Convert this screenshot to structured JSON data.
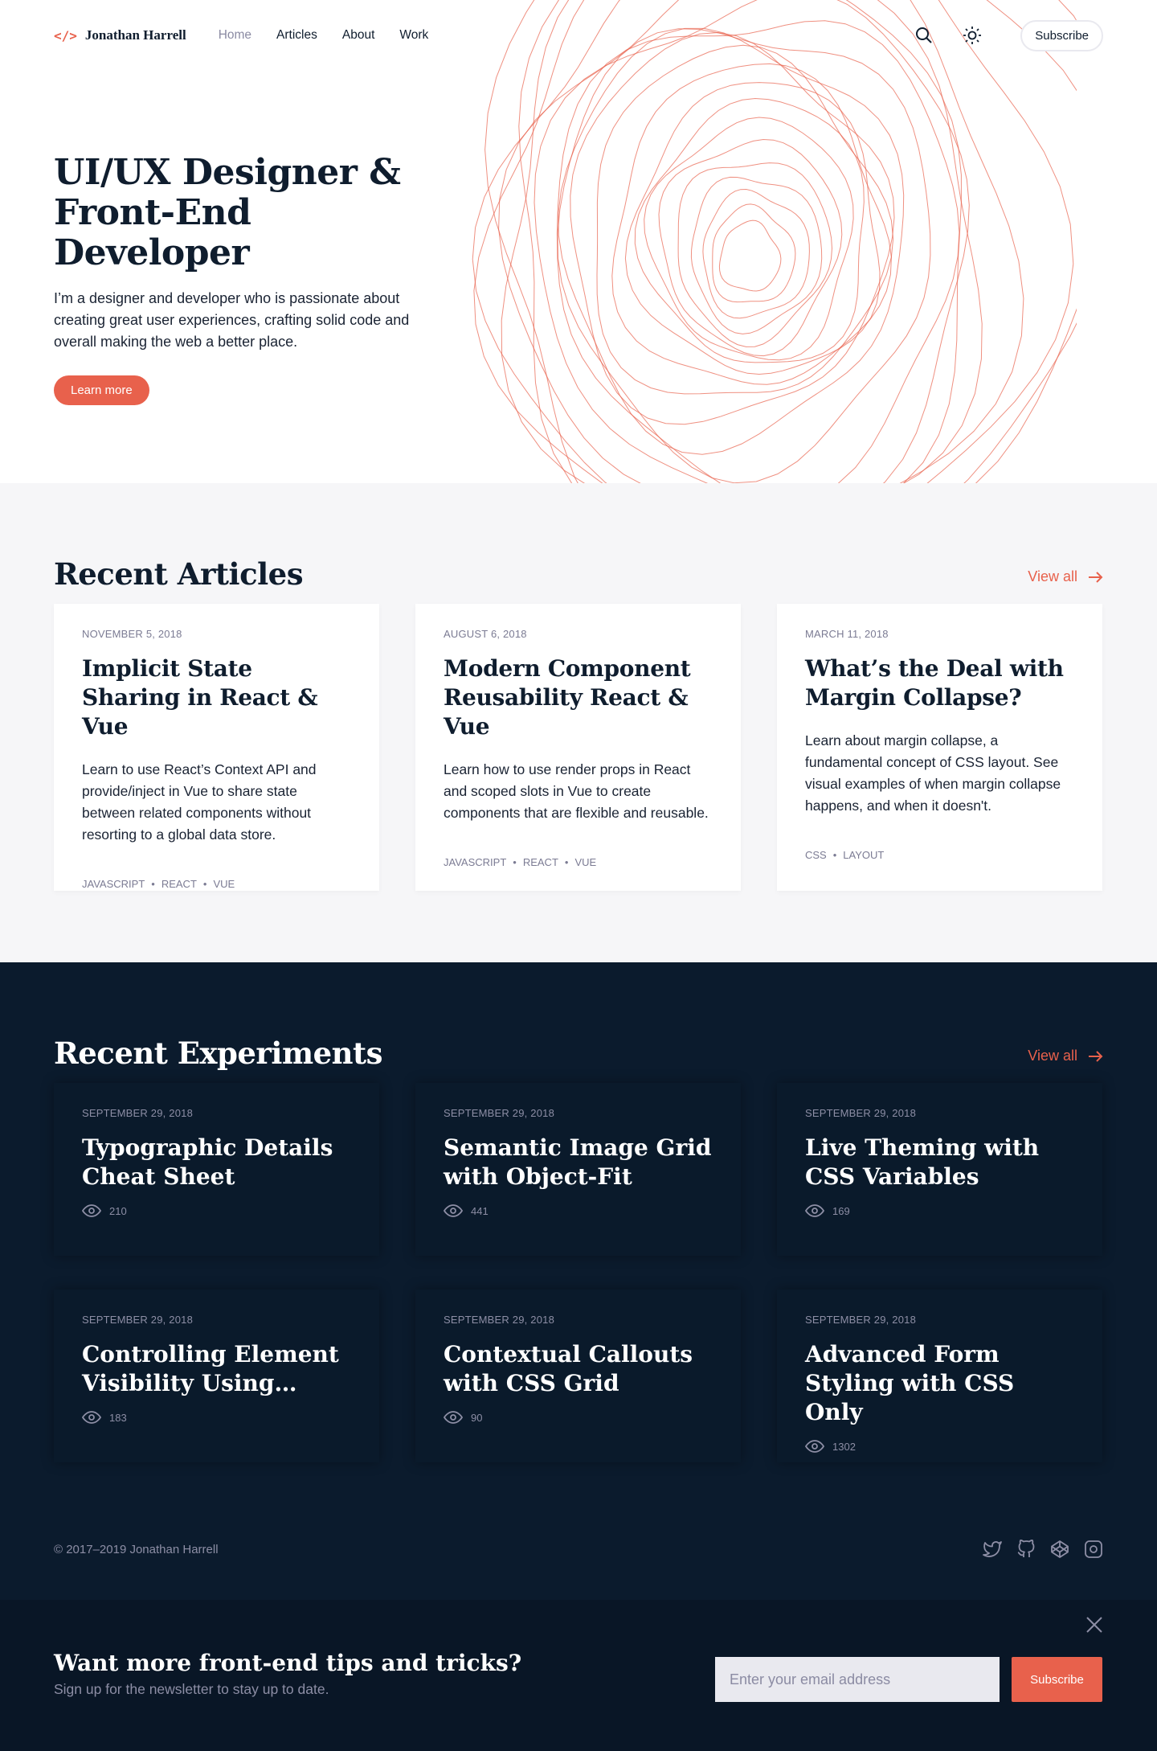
{
  "header": {
    "brand": "Jonathan Harrell",
    "nav": [
      "Home",
      "Articles",
      "About",
      "Work"
    ],
    "subscribe": "Subscribe"
  },
  "hero": {
    "title_line1": "UI/UX Designer &",
    "title_line2": "Front-End Developer",
    "body": "I’m a designer and developer who is passionate about creating great user experiences, crafting solid code and overall making the web a better place.",
    "cta": "Learn more"
  },
  "articles": {
    "heading": "Recent Articles",
    "view_all": "View all",
    "items": [
      {
        "date": "November 5, 2018",
        "title": "Implicit State Sharing in React & Vue",
        "desc": "Learn to use React’s Context API and provide/inject in Vue to share state between related components without resorting to a global data store.",
        "tags": [
          "JAVASCRIPT",
          "REACT",
          "VUE"
        ]
      },
      {
        "date": "August 6, 2018",
        "title": "Modern Component Reusability React & Vue",
        "desc": "Learn how to use render props in React and scoped slots in Vue to create components that are flexible and reusable.",
        "tags": [
          "JAVASCRIPT",
          "REACT",
          "VUE"
        ]
      },
      {
        "date": "March 11, 2018",
        "title": "What’s the Deal with Margin Collapse?",
        "desc": "Learn about margin collapse, a fundamental concept of CSS layout. See visual examples of when margin collapse happens, and when it doesn't.",
        "tags": [
          "CSS",
          "LAYOUT"
        ]
      }
    ]
  },
  "experiments": {
    "heading": "Recent Experiments",
    "view_all": "View all",
    "items": [
      {
        "date": "September 29, 2018",
        "title": "Typographic Details Cheat Sheet",
        "views": "210"
      },
      {
        "date": "September 29, 2018",
        "title": "Semantic Image Grid with Object-Fit",
        "views": "441"
      },
      {
        "date": "September 29, 2018",
        "title": "Live Theming with CSS Variables",
        "views": "169"
      },
      {
        "date": "September 29, 2018",
        "title": "Controlling Element Visibility Using…",
        "views": "183"
      },
      {
        "date": "September 29, 2018",
        "title": "Contextual Callouts with CSS Grid",
        "views": "90"
      },
      {
        "date": "September 29, 2018",
        "title": "Advanced Form Styling with CSS Only",
        "views": "1302"
      }
    ]
  },
  "footer": {
    "copyright": "© 2017–2019 Jonathan Harrell",
    "social": [
      "twitter-icon",
      "github-icon",
      "codepen-icon",
      "instagram-icon"
    ]
  },
  "newsletter": {
    "heading": "Want more front-end tips and tricks?",
    "subtext": "Sign up for the newsletter to stay up to date.",
    "placeholder": "Enter your email address",
    "button": "Subscribe"
  },
  "colors": {
    "accent": "#e8614c",
    "dark": "#0b1b2d"
  }
}
